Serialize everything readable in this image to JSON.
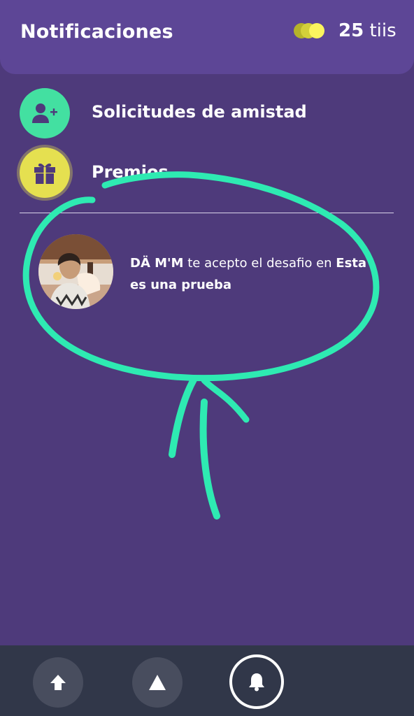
{
  "header": {
    "title": "Notificaciones",
    "coins": {
      "count": "25",
      "unit": "tiis"
    }
  },
  "menu": {
    "friend_requests": {
      "label": "Solicitudes de amistad",
      "icon": "add-friend-icon"
    },
    "prizes": {
      "label": "Premios",
      "icon": "gift-icon"
    }
  },
  "notification": {
    "user": "DÄ M'M",
    "message": "te acepto el desafio en",
    "challenge": "Esta es una prueba",
    "avatar_icon": "user-avatar"
  },
  "bottom_nav": [
    {
      "name": "home",
      "icon": "home-icon"
    },
    {
      "name": "challenges",
      "icon": "triangle-icon"
    },
    {
      "name": "notifications",
      "icon": "bell-icon",
      "active": true
    },
    {
      "name": "profile",
      "icon": "user-avatar"
    }
  ],
  "colors": {
    "background": "#4e3a7b",
    "header": "#5d4696",
    "green": "#43e0a1",
    "yellow": "#e5e050",
    "bottom_bar": "#313749",
    "annotation": "#2eeab2"
  }
}
